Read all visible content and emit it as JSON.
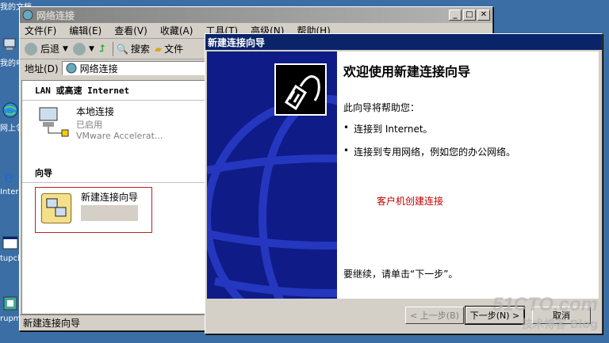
{
  "desktop": {
    "top_label": "我的文档",
    "icons": [
      {
        "name": "network-icon",
        "label": "我的电"
      },
      {
        "name": "globe-icon",
        "label": "网上邻"
      },
      {
        "name": "ie-icon",
        "label": "Intern Explo"
      },
      {
        "name": "window-icon",
        "label": "tupcl"
      },
      {
        "name": "app-icon",
        "label": "rupma"
      }
    ]
  },
  "explorer": {
    "title": "网络连接",
    "menu": [
      "文件(F)",
      "编辑(E)",
      "查看(V)",
      "收藏(A)",
      "工具(T)",
      "高级(N)",
      "帮助(H)"
    ],
    "toolbar": {
      "back": "后退",
      "search": "搜索",
      "folders": "文件"
    },
    "address": {
      "label": "地址(D)",
      "value": "网络连接"
    },
    "section_lan": "LAN 或高速 Internet",
    "local_conn": {
      "name": "本地连接",
      "status": "已启用",
      "device": "VMware Accelerat..."
    },
    "section_wizard": "向导",
    "wizard_item": "新建连接向导",
    "status": "新建连接向导"
  },
  "wizard": {
    "title": "新建连接向导",
    "heading": "欢迎使用新建连接向导",
    "intro": "此向导将帮助您：",
    "bullets": [
      "连接到 Internet。",
      "连接到专用网络，例如您的办公网络。"
    ],
    "annotation": "客户机创建连接",
    "continue": "要继续，请单击“下一步”。",
    "buttons": {
      "back": "< 上一步(B)",
      "next": "下一步(N) >",
      "cancel": "取消"
    }
  },
  "watermark": {
    "line1": "51CTO.com",
    "line2": "技术博客 Blog"
  },
  "colors": {
    "desktop": "#3a6ea5",
    "wizard_title": "#0a246a",
    "annotation": "#c00000",
    "wizard_side": "#0f1b87"
  }
}
